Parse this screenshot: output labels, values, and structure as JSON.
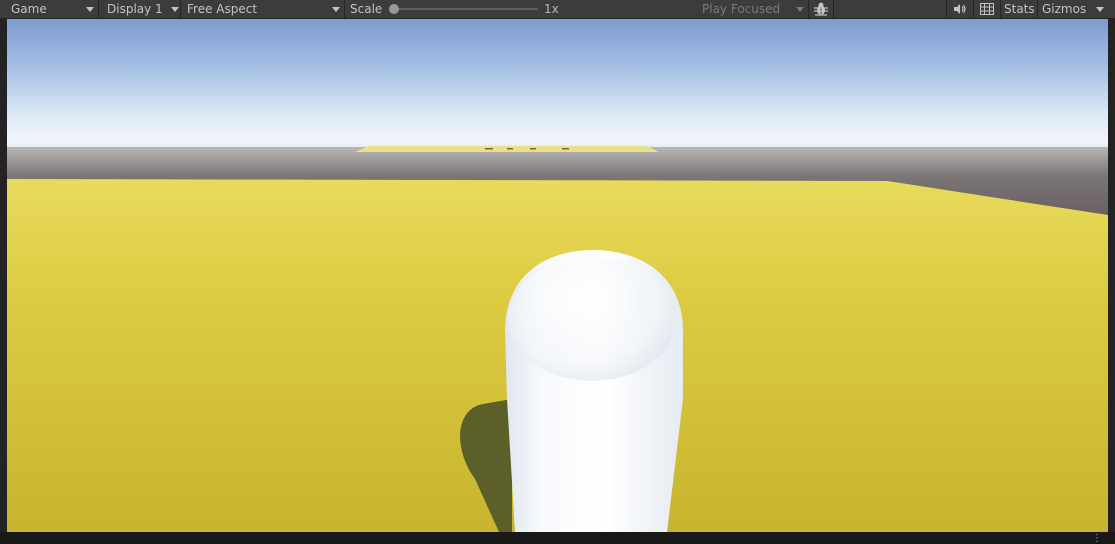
{
  "toolbar": {
    "view_mode": {
      "label": "Game"
    },
    "display": {
      "label": "Display 1"
    },
    "aspect": {
      "label": "Free Aspect"
    },
    "scale": {
      "label": "Scale",
      "value_text": "1x",
      "value": 1
    },
    "play_mode": {
      "label": "Play Focused"
    },
    "stats_label": "Stats",
    "gizmos_label": "Gizmos"
  },
  "icons": {
    "bug": "bug-icon",
    "audio": "speaker-icon",
    "grid": "keyboard-grid-icon",
    "more": "more-dots-icon"
  },
  "scene": {
    "sky_top_color": "#7e9bcf",
    "horizon_color": "#f2f6fb",
    "ground_color": "#d9c43d",
    "far_ground_color": "#6e6668",
    "capsule_color": "#f4f6fa",
    "shadow_color": "#565a28"
  }
}
